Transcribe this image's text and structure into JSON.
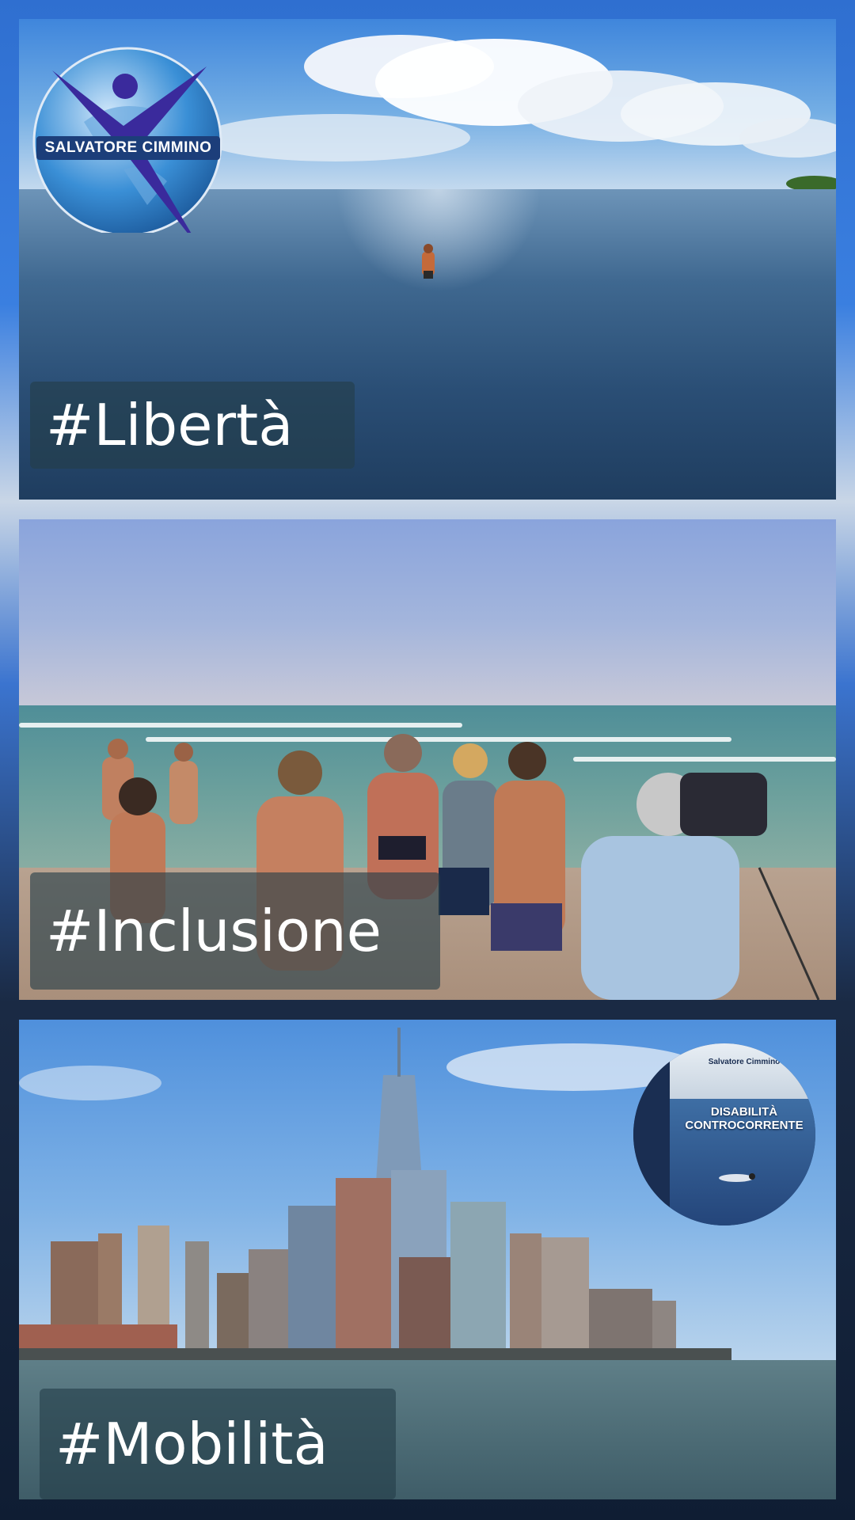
{
  "panels": [
    {
      "hashtag": "#Libertà"
    },
    {
      "hashtag": "#Inclusione"
    },
    {
      "hashtag": "#Mobilità"
    }
  ],
  "logo": {
    "text": "SALVATORE CIMMINO",
    "colors": {
      "globe": "#3a8fd6",
      "figure": "#3a2a9c",
      "band": "#1c3e7a"
    }
  },
  "book": {
    "author": "Salvatore Cimmino",
    "title_line1": "DISABILITÀ",
    "title_line2": "CONTROCORRENTE"
  },
  "colors": {
    "frame": "#2f6fd0",
    "tag_background": "#243e48"
  }
}
